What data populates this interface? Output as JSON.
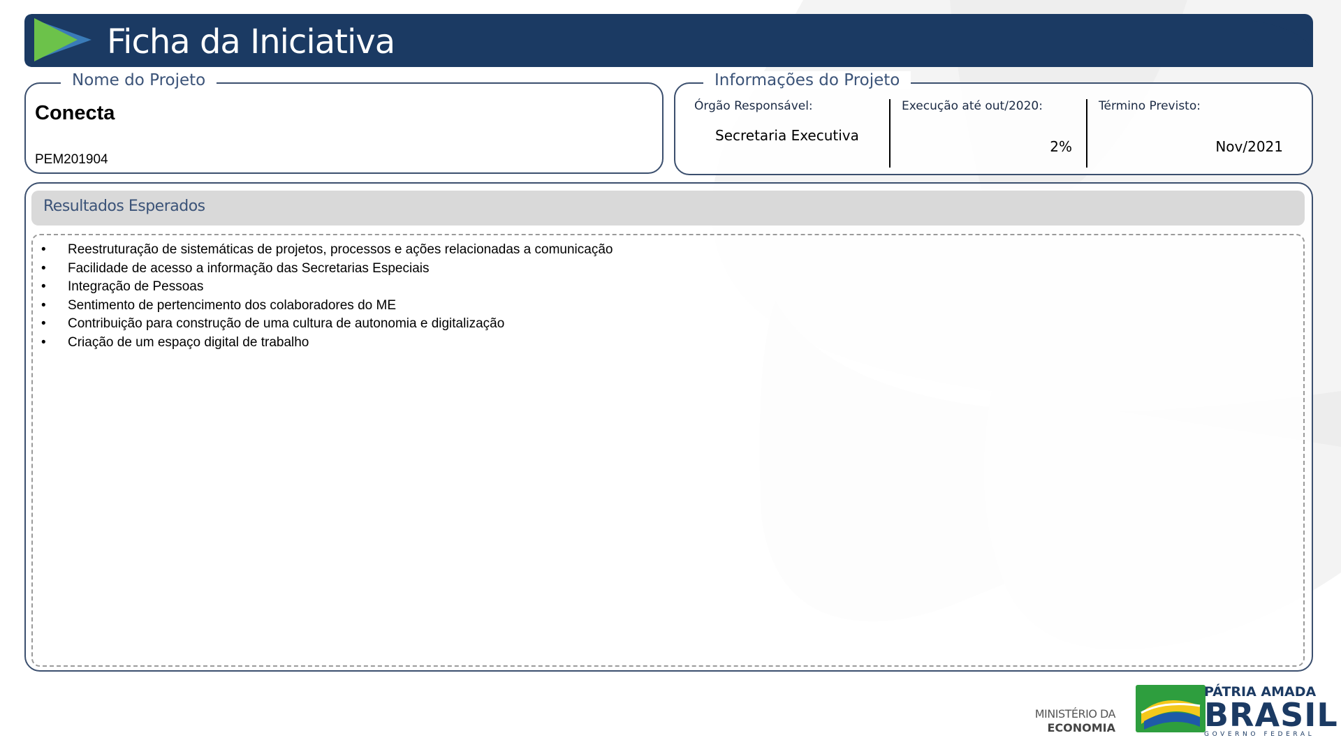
{
  "header": {
    "title": "Ficha da Iniciativa"
  },
  "project": {
    "legend": "Nome do Projeto",
    "name": "Conecta",
    "code": "PEM201904"
  },
  "info": {
    "legend": "Informações do Projeto",
    "orgao_label": "Órgão Responsável:",
    "orgao_value": "Secretaria Executiva",
    "execucao_label": "Execução até out/2020:",
    "execucao_value": "2%",
    "termino_label": "Término Previsto:",
    "termino_value": "Nov/2021"
  },
  "results": {
    "title": "Resultados Esperados",
    "bullet": "•",
    "items": [
      "Reestruturação de sistemáticas de projetos, processos e ações relacionadas a comunicação",
      "Facilidade de acesso a informação das Secretarias Especiais",
      "Integração de Pessoas",
      "Sentimento de pertencimento dos colaboradores do ME",
      "Contribuição para construção de uma cultura de autonomia e digitalização",
      "Criação de um espaço digital de trabalho"
    ]
  },
  "footer": {
    "ministry_line1": "MINISTÉRIO DA",
    "ministry_line2": "ECONOMIA",
    "brand_line1": "PÁTRIA AMADA",
    "brand_line2": "BRASIL",
    "brand_line3": "GOVERNO FEDERAL"
  },
  "colors": {
    "header_bg": "#1b3a63",
    "border": "#3b4f6e",
    "legend_text": "#3b5378",
    "results_bar": "#d9d9d9",
    "flag_green": "#2e9e3e",
    "flag_yellow": "#f4c81b",
    "flag_blue": "#1e5aa8"
  }
}
